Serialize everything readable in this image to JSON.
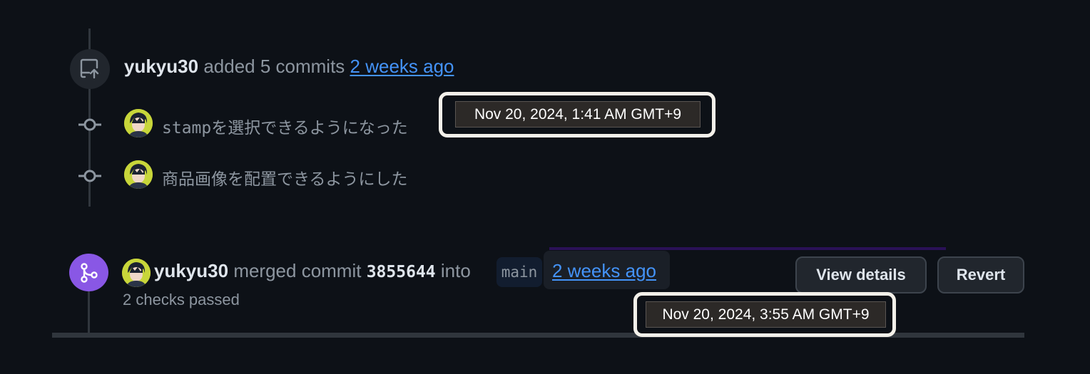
{
  "push_event": {
    "author": "yukyu30",
    "action": "added 5 commits",
    "time_relative": "2 weeks ago",
    "tooltip": "Nov 20, 2024, 1:41 AM GMT+9"
  },
  "commits": [
    {
      "message": "stampを選択できるようになった"
    },
    {
      "message": "商品画像を配置できるようにした"
    }
  ],
  "merge_event": {
    "author": "yukyu30",
    "action_1": "merged commit",
    "sha": "3855644",
    "action_2": "into",
    "branch": "main",
    "time_relative": "2 weeks ago",
    "checks": "2 checks passed",
    "tooltip": "Nov 20, 2024, 3:55 AM GMT+9",
    "view_details_label": "View details",
    "revert_label": "Revert"
  },
  "colors": {
    "merge_badge": "#8957e5",
    "link": "#4493f8",
    "background": "#0d1117"
  }
}
